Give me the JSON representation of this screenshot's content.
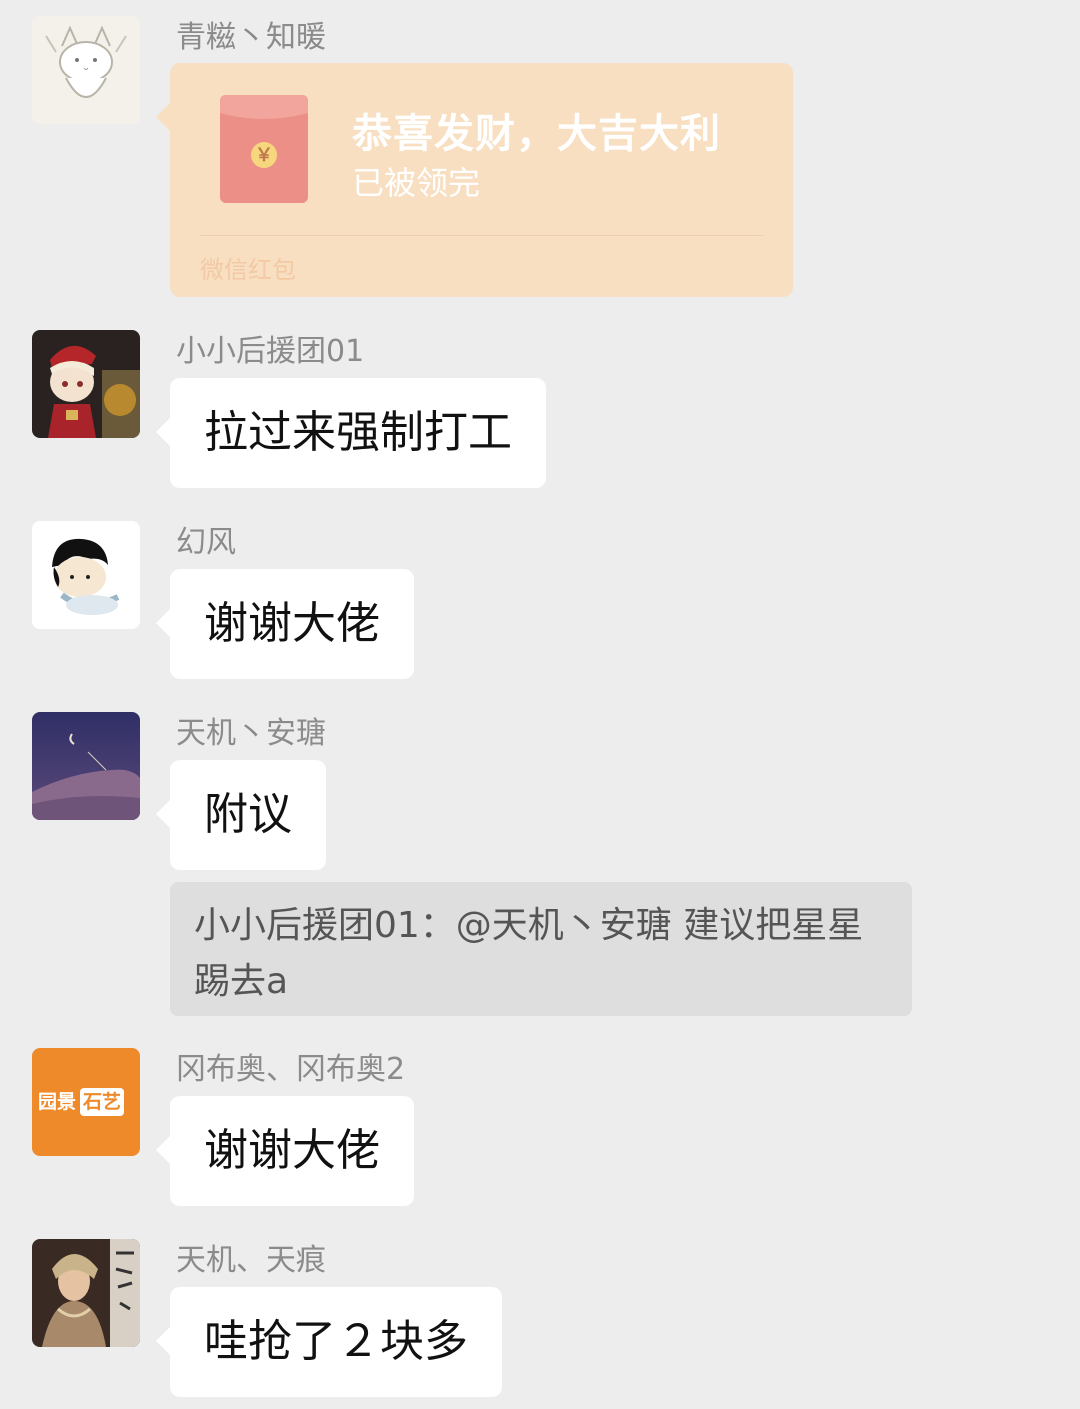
{
  "messages": [
    {
      "sender": "青糍丶知暖",
      "red_packet": {
        "title": "恭喜发财，大吉大利",
        "status": "已被领完",
        "footer": "微信红包",
        "symbol": "￥"
      }
    },
    {
      "sender": "小小后援团01",
      "text": "拉过来强制打工"
    },
    {
      "sender": "幻风",
      "text": "谢谢大佬"
    },
    {
      "sender": "天机丶安瑭",
      "text": "附议",
      "quote_line1": "小小后援团01：@天机丶安瑭 建议把星星",
      "quote_line2": "踢去a"
    },
    {
      "sender": "冈布奥、冈布奥2",
      "text": "谢谢大佬",
      "avatar_text_1": "园景",
      "avatar_text_2": "石艺"
    },
    {
      "sender": "天机、天痕",
      "text": "哇抢了２块多"
    }
  ],
  "colors": {
    "background": "#ededed",
    "bubble": "#ffffff",
    "red_packet": "#f8dfc2",
    "quote_bg": "#dedede",
    "name_text": "#8b8b8b"
  }
}
